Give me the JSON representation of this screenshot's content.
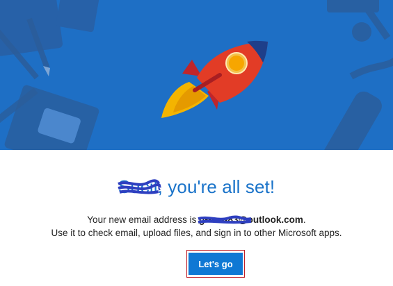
{
  "colors": {
    "hero_background": "#1e6fc5",
    "accent": "#0f78d4",
    "headline": "#1a73c9",
    "highlight_border": "#c0202a"
  },
  "illustration": {
    "main_icon": "rocket-icon",
    "decorations": [
      "pencil-icon",
      "book-icon",
      "wrench-icon",
      "brush-icon",
      "folder-icon"
    ]
  },
  "greeting": {
    "name": "Sucil",
    "suffix": ", you're all set!"
  },
  "message": {
    "line1_prefix": "Your new email address is ",
    "email_redacted_part": "g•••••••83",
    "email_domain": "@outlook.com",
    "line1_end": ".",
    "line2": "Use it to check email, upload files, and sign in to other Microsoft apps."
  },
  "button": {
    "label": "Let's go"
  }
}
